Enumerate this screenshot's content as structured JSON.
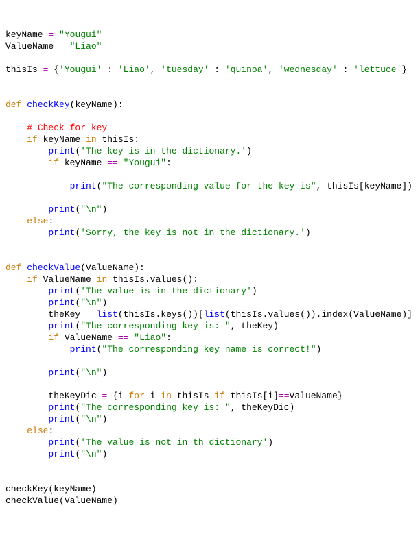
{
  "l1": {
    "v1": "keyName ",
    "op": "=",
    "s": " \"Yougui\""
  },
  "l2": {
    "v1": "ValueName ",
    "op": "=",
    "s": " \"Liao\""
  },
  "l4": {
    "v1": "thisIs ",
    "op": "=",
    "rest": " {",
    "s1": "'Yougui'",
    "c1": " : ",
    "s2": "'Liao'",
    "c2": ", ",
    "s3": "'tuesday'",
    "c3": " : ",
    "s4": "'quinoa'",
    "c4": ", ",
    "s5": "'wednesday'",
    "c5": " : ",
    "s6": "'lettuce'",
    "end": "}"
  },
  "l7": {
    "kw": "def",
    "sp": " ",
    "fn": "checkKey",
    "rest": "(keyName):"
  },
  "l9": {
    "indent": "    ",
    "cmt": "# Check for key"
  },
  "l10": {
    "indent": "    ",
    "kw1": "if",
    "mid": " keyName ",
    "kw2": "in",
    "rest": " thisIs:"
  },
  "l11": {
    "indent": "        ",
    "fn": "print",
    "p1": "(",
    "s": "'The key is in the dictionary.'",
    "p2": ")"
  },
  "l12": {
    "indent": "        ",
    "kw": "if",
    "mid": " keyName ",
    "op": "==",
    "sp": " ",
    "s": "\"Yougui\"",
    "end": ":"
  },
  "l14": {
    "indent": "            ",
    "fn": "print",
    "p1": "(",
    "s": "\"The corresponding value for the key is\"",
    "rest": ", thisIs[keyName])"
  },
  "l16": {
    "indent": "        ",
    "fn": "print",
    "p1": "(",
    "s": "\"\\n\"",
    "p2": ")"
  },
  "l17": {
    "indent": "    ",
    "kw": "else",
    "end": ":"
  },
  "l18": {
    "indent": "        ",
    "fn": "print",
    "p1": "(",
    "s": "'Sorry, the key is not in the dictionary.'",
    "p2": ")"
  },
  "l21": {
    "kw": "def",
    "sp": " ",
    "fn": "checkValue",
    "rest": "(ValueName):"
  },
  "l22": {
    "indent": "    ",
    "kw1": "if",
    "mid": " ValueName ",
    "kw2": "in",
    "rest": " thisIs.values():"
  },
  "l23": {
    "indent": "        ",
    "fn": "print",
    "p1": "(",
    "s": "'The value is in the dictionary'",
    "p2": ")"
  },
  "l24": {
    "indent": "        ",
    "fn": "print",
    "p1": "(",
    "s": "\"\\n\"",
    "p2": ")"
  },
  "l25": {
    "indent": "        ",
    "v": "theKey ",
    "op": "=",
    "sp": " ",
    "fn1": "list",
    "p1": "(thisIs.keys())[",
    "fn2": "list",
    "p2": "(thisIs.values()).index(ValueName)]"
  },
  "l26": {
    "indent": "        ",
    "fn": "print",
    "p1": "(",
    "s": "\"The corresponding key is: \"",
    "rest": ", theKey)"
  },
  "l27": {
    "indent": "        ",
    "kw": "if",
    "mid": " ValueName ",
    "op": "==",
    "sp": " ",
    "s": "\"Liao\"",
    "end": ":"
  },
  "l28": {
    "indent": "            ",
    "fn": "print",
    "p1": "(",
    "s": "\"The corresponding key name is correct!\"",
    "p2": ")"
  },
  "l30": {
    "indent": "        ",
    "fn": "print",
    "p1": "(",
    "s": "\"\\n\"",
    "p2": ")"
  },
  "l32": {
    "indent": "        ",
    "v": "theKeyDic ",
    "op": "=",
    "rest1": " {i ",
    "kw1": "for",
    "rest2": " i ",
    "kw2": "in",
    "rest3": " thisIs ",
    "kw3": "if",
    "rest4": " thisIs[i]",
    "op2": "==",
    "rest5": "ValueName}"
  },
  "l33": {
    "indent": "        ",
    "fn": "print",
    "p1": "(",
    "s": "\"The corresponding key is: \"",
    "rest": ", theKeyDic)"
  },
  "l34": {
    "indent": "        ",
    "fn": "print",
    "p1": "(",
    "s": "\"\\n\"",
    "p2": ")"
  },
  "l35": {
    "indent": "    ",
    "kw": "else",
    "end": ":"
  },
  "l36": {
    "indent": "        ",
    "fn": "print",
    "p1": "(",
    "s": "'The value is not in th dictionary'",
    "p2": ")"
  },
  "l37": {
    "indent": "        ",
    "fn": "print",
    "p1": "(",
    "s": "\"\\n\"",
    "p2": ")"
  },
  "l40": {
    "t": "checkKey(keyName)"
  },
  "l41": {
    "t": "checkValue(ValueName)"
  }
}
